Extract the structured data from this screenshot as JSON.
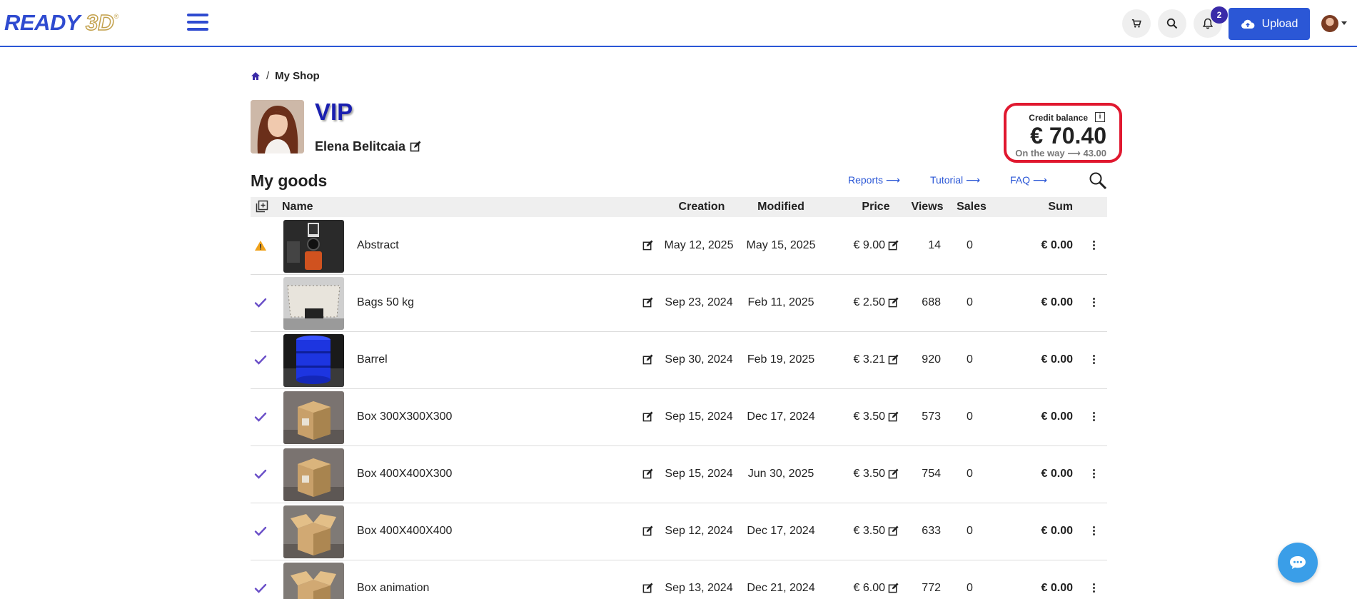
{
  "header": {
    "logo_text": "READY",
    "logo_3d": "3D",
    "logo_reg": "®",
    "notification_count": "2",
    "upload_label": "Upload",
    "icons": [
      "menu-icon",
      "cart-icon",
      "search-icon",
      "bell-icon",
      "cloud-upload-icon"
    ]
  },
  "breadcrumb": {
    "separator": "/",
    "current": "My Shop"
  },
  "profile": {
    "level": "VIP",
    "name": "Elena Belitcaia"
  },
  "credit": {
    "label": "Credit balance",
    "info": "i",
    "amount": "€ 70.40",
    "on_the_way": "On the way ⟶ 43.00"
  },
  "goods": {
    "title": "My goods",
    "links": {
      "reports": "Reports ⟶",
      "tutorial": "Tutorial ⟶",
      "faq": "FAQ ⟶"
    },
    "columns": {
      "name": "Name",
      "creation": "Creation",
      "modified": "Modified",
      "price": "Price",
      "views": "Views",
      "sales": "Sales",
      "sum": "Sum"
    },
    "rows": [
      {
        "status": "warning",
        "name": "Abstract",
        "creation": "May 12, 2025",
        "modified": "May 15, 2025",
        "price": "€ 9.00",
        "views": "14",
        "sales": "0",
        "sum": "€ 0.00",
        "thumb": "dark"
      },
      {
        "status": "ok",
        "name": "Bags 50 kg",
        "creation": "Sep 23, 2024",
        "modified": "Feb 11, 2025",
        "price": "€ 2.50",
        "views": "688",
        "sales": "0",
        "sum": "€ 0.00",
        "thumb": "bags"
      },
      {
        "status": "ok",
        "name": "Barrel",
        "creation": "Sep 30, 2024",
        "modified": "Feb 19, 2025",
        "price": "€ 3.21",
        "views": "920",
        "sales": "0",
        "sum": "€ 0.00",
        "thumb": "barrel"
      },
      {
        "status": "ok",
        "name": "Box 300X300X300",
        "creation": "Sep 15, 2024",
        "modified": "Dec 17, 2024",
        "price": "€ 3.50",
        "views": "573",
        "sales": "0",
        "sum": "€ 0.00",
        "thumb": "box"
      },
      {
        "status": "ok",
        "name": "Box 400X400X300",
        "creation": "Sep 15, 2024",
        "modified": "Jun 30, 2025",
        "price": "€ 3.50",
        "views": "754",
        "sales": "0",
        "sum": "€ 0.00",
        "thumb": "box"
      },
      {
        "status": "ok",
        "name": "Box 400X400X400",
        "creation": "Sep 12, 2024",
        "modified": "Dec 17, 2024",
        "price": "€ 3.50",
        "views": "633",
        "sales": "0",
        "sum": "€ 0.00",
        "thumb": "openbox"
      },
      {
        "status": "ok",
        "name": "Box animation",
        "creation": "Sep 13, 2024",
        "modified": "Dec 21, 2024",
        "price": "€ 6.00",
        "views": "772",
        "sales": "0",
        "sum": "€ 0.00",
        "thumb": "openbox"
      }
    ]
  },
  "colors": {
    "brand_blue": "#2b57d6",
    "vip_blue": "#1a1fb0",
    "highlight_red": "#e0182f",
    "check_purple": "#6a4fc8",
    "warning_orange": "#f0a21a",
    "chat_blue": "#3a9ee8"
  }
}
